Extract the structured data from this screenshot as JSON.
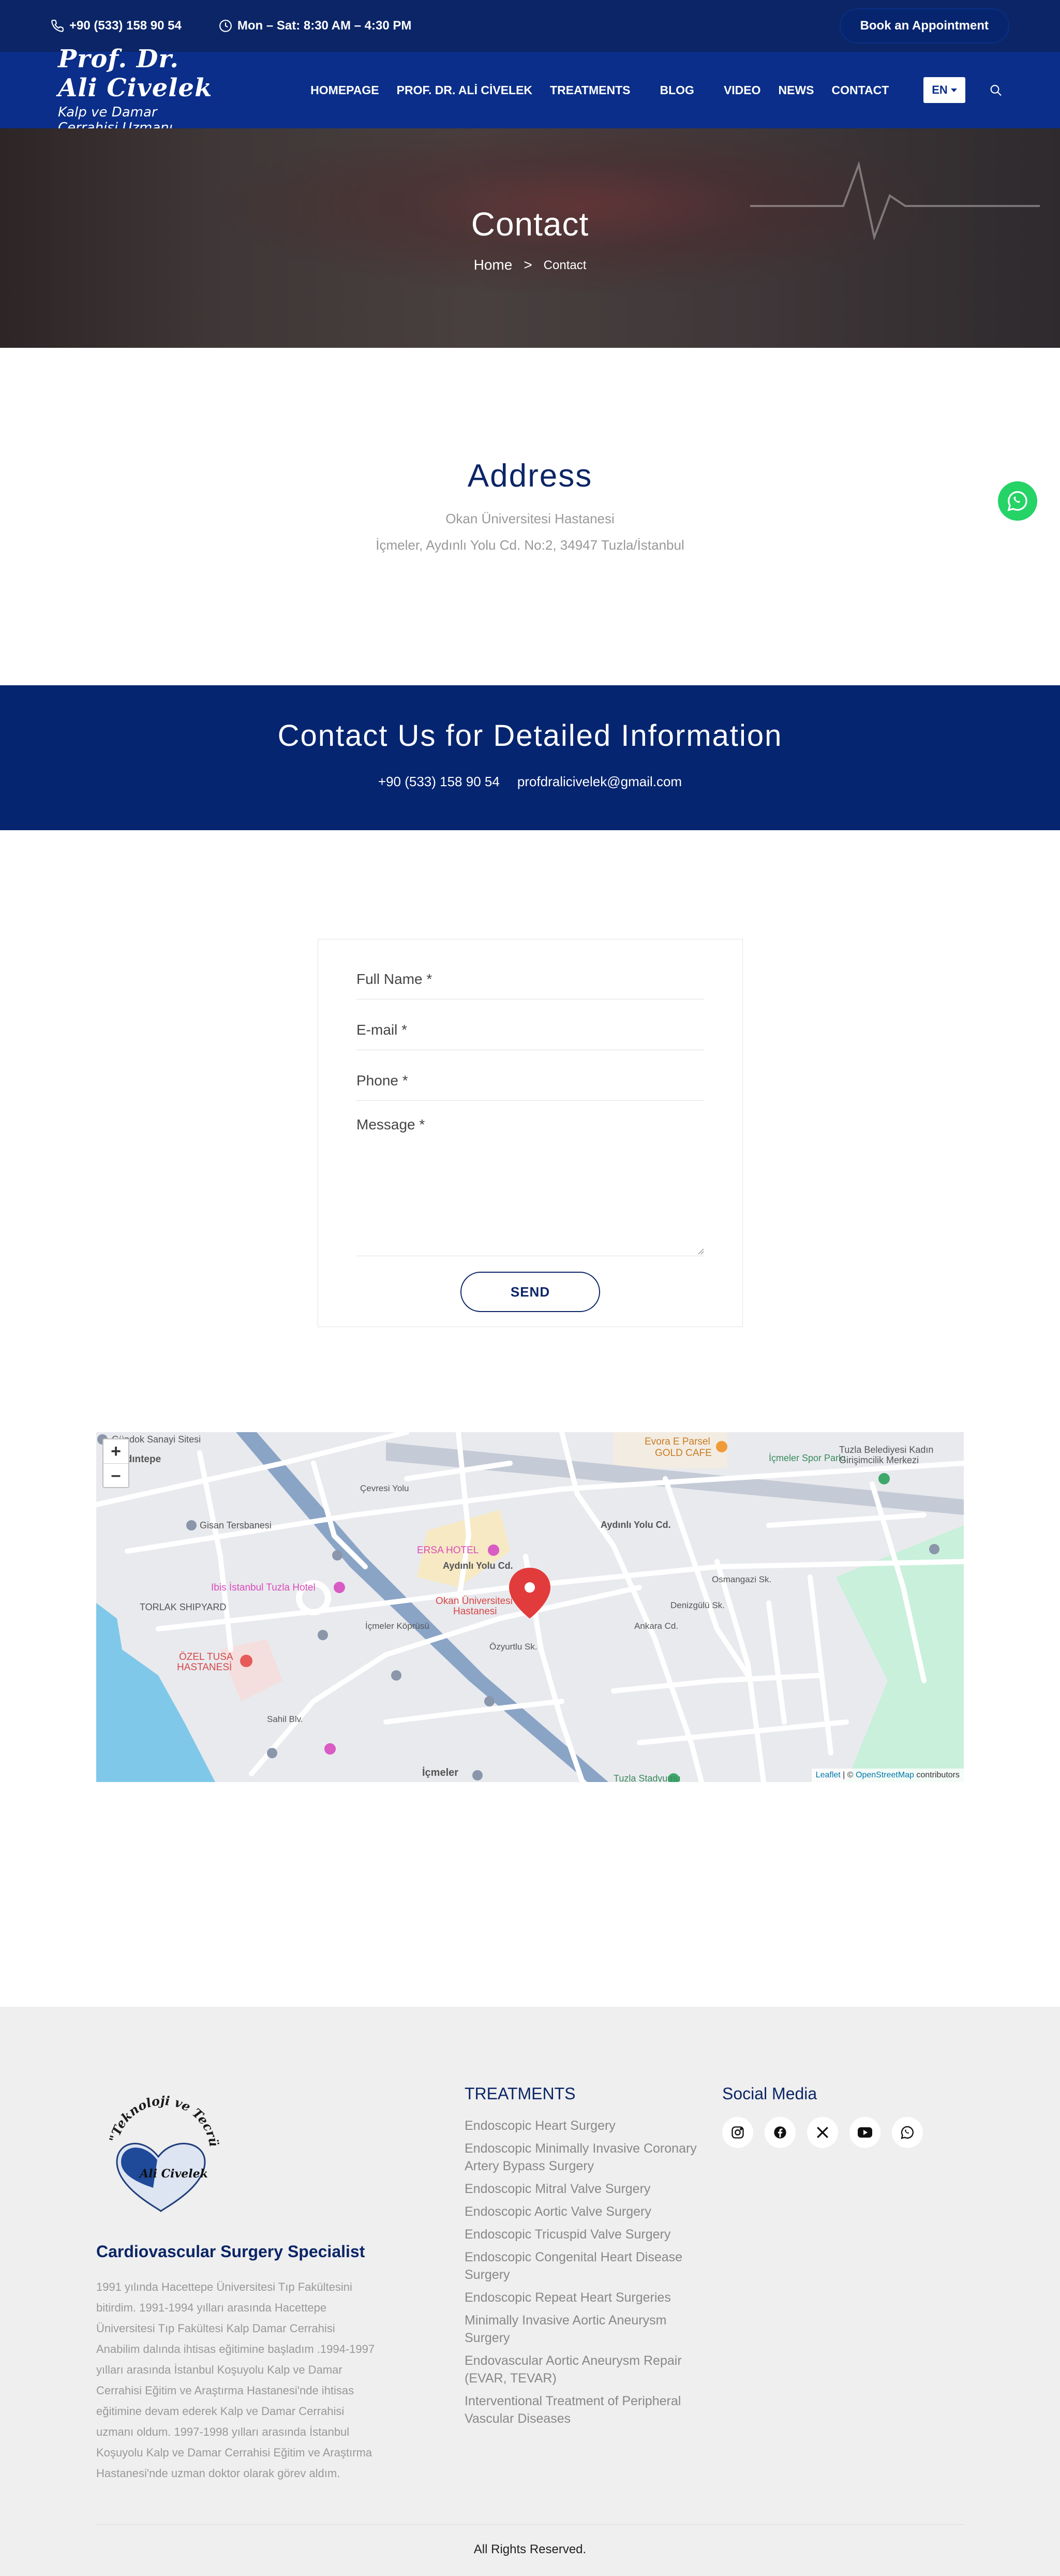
{
  "topbar": {
    "phone": "+90 (533) 158 90 54",
    "hours": "Mon – Sat: 8:30 AM – 4:30 PM",
    "book_label": "Book an Appointment"
  },
  "nav": {
    "logo_line1": "Prof. Dr. Ali Civelek",
    "logo_line2": "Kalp ve Damar Cerrahisi Uzmanı",
    "items": [
      "HOMEPAGE",
      "PROF. DR. ALİ CİVELEK",
      "TREATMENTS",
      "BLOG",
      "VIDEO",
      "NEWS",
      "CONTACT"
    ],
    "language": "EN"
  },
  "hero": {
    "title": "Contact",
    "crumb_home": "Home",
    "crumb_sep": ">",
    "crumb_current": "Contact"
  },
  "address": {
    "title": "Address",
    "line1": "Okan Üniversitesi Hastanesi",
    "line2": "İçmeler, Aydınlı Yolu Cd. No:2, 34947 Tuzla/İstanbul"
  },
  "band": {
    "title": "Contact Us for Detailed Information",
    "phone": "+90 (533) 158 90 54",
    "email": "profdralicivelek@gmail.com"
  },
  "form": {
    "full_name": "Full Name *",
    "email": "E-mail *",
    "phone": "Phone *",
    "message": "Message *",
    "send_label": "SEND"
  },
  "map": {
    "zoom_in": "+",
    "zoom_out": "–",
    "attrib_leaflet": "Leaflet",
    "attrib_sep": " | © ",
    "attrib_osm": "OpenStreetMap",
    "attrib_tail": " contributors",
    "labels": {
      "aydintepe": "Aydıntepe",
      "gisan": "Gisan Tersbanesi",
      "ibis": "Ibis İstanbul Tuzla Hotel",
      "tuzla_shipyard": "TORLAK SHIPYARD",
      "ozel_tuna": "ÖZEL TUSA",
      "hastanesi": "HASTANESİ",
      "ersa": "ERSA HOTEL",
      "okan": "Okan Üniversitesi",
      "okan2": "Hastanesi",
      "evora": "Evora E Parsel",
      "gold_cafe": "GOLD CAFE",
      "icmeler_park": "İçmeler Spor Parkı",
      "tuzla_bel": "Tuzla Belediyesi Kadın",
      "tuzla_bel2": "Girişimcilik Merkezi",
      "icmeler": "İçmeler",
      "aydinli_yolu": "Aydınlı Yolu Cd.",
      "aydinli_yolu2": "Aydınlı Yolu Cd.",
      "icmeler_koprusu": "İçmeler Köprüsü",
      "ozyurtlu": "Özyurtlu Sk.",
      "ankara": "Ankara Cd.",
      "osmangazi": "Osmangazi Sk.",
      "denizgulu": "Denizgülü Sk.",
      "tuzla_stad": "Tuzla Stadyumu",
      "cevre_yolu": "Çevresi Yolu",
      "sahil": "Sahil Blv."
    }
  },
  "footer": {
    "seal_text": "\"Teknoloji ve Tecrübe El Ele\"",
    "seal_name": "Ali Civelek",
    "specialist": "Cardiovascular Surgery Specialist",
    "bio": "1991 yılında Hacettepe Üniversitesi Tıp Fakültesini bitirdim. 1991-1994 yılları arasında Hacettepe Üniversitesi Tıp Fakültesi Kalp Damar Cerrahisi Anabilim dalında ihtisas eğitimine başladım .1994-1997 yılları arasında İstanbul Koşuyolu Kalp ve Damar Cerrahisi Eğitim ve Araştırma Hastanesi'nde ihtisas eğitimine devam ederek Kalp ve Damar Cerrahisi uzmanı oldum. 1997-1998 yılları arasında İstanbul Koşuyolu Kalp ve Damar Cerrahisi Eğitim ve Araştırma Hastanesi'nde uzman doktor olarak görev aldım.",
    "treatments_title": "TREATMENTS",
    "treatments": [
      "Endoscopic Heart Surgery",
      "Endoscopic Minimally Invasive Coronary Artery Bypass Surgery",
      "Endoscopic Mitral Valve Surgery",
      "Endoscopic Aortic Valve Surgery",
      "Endoscopic Tricuspid Valve Surgery",
      "Endoscopic Congenital Heart Disease Surgery",
      "Endoscopic Repeat Heart Surgeries",
      "Minimally Invasive Aortic Aneurysm Surgery",
      "Endovascular Aortic Aneurysm Repair (EVAR, TEVAR)",
      "Interventional Treatment of Peripheral Vascular Diseases"
    ],
    "social_title": "Social Media",
    "rights": "All Rights Reserved."
  },
  "colors": {
    "navy": "#0b2566",
    "nav_blue": "#0a2e89",
    "whatsapp": "#25d366",
    "footer_bg": "#efefef"
  }
}
